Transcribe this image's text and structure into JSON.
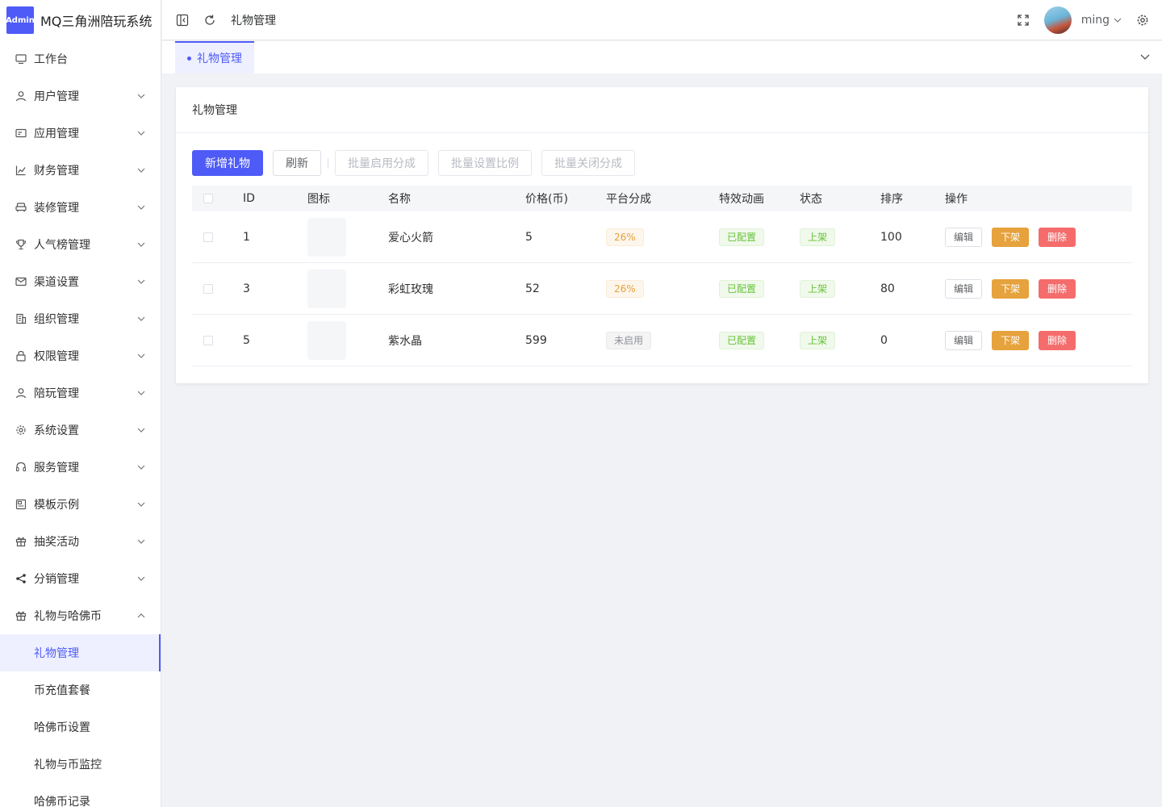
{
  "app": {
    "logo_badge": "Admin",
    "title": "MQ三角洲陪玩系统"
  },
  "sidebar": {
    "items": [
      {
        "label": "工作台",
        "icon": "monitor-icon",
        "expandable": false
      },
      {
        "label": "用户管理",
        "icon": "user-icon",
        "expandable": true
      },
      {
        "label": "应用管理",
        "icon": "card-icon",
        "expandable": true
      },
      {
        "label": "财务管理",
        "icon": "bar-chart-icon",
        "expandable": true
      },
      {
        "label": "装修管理",
        "icon": "sofa-icon",
        "expandable": true
      },
      {
        "label": "人气榜管理",
        "icon": "trophy-icon",
        "expandable": true
      },
      {
        "label": "渠道设置",
        "icon": "mail-icon",
        "expandable": true
      },
      {
        "label": "组织管理",
        "icon": "building-icon",
        "expandable": true
      },
      {
        "label": "权限管理",
        "icon": "lock-icon",
        "expandable": true
      },
      {
        "label": "陪玩管理",
        "icon": "user-icon",
        "expandable": true
      },
      {
        "label": "系统设置",
        "icon": "gear-icon",
        "expandable": true
      },
      {
        "label": "服务管理",
        "icon": "headset-icon",
        "expandable": true
      },
      {
        "label": "模板示例",
        "icon": "template-icon",
        "expandable": true
      },
      {
        "label": "抽奖活动",
        "icon": "gift-icon",
        "expandable": true
      },
      {
        "label": "分销管理",
        "icon": "share-icon",
        "expandable": true
      },
      {
        "label": "礼物与哈佛币",
        "icon": "gift-icon",
        "expandable": true,
        "expanded": true
      }
    ],
    "submenu": [
      {
        "label": "礼物管理",
        "active": true
      },
      {
        "label": "币充值套餐",
        "active": false
      },
      {
        "label": "哈佛币设置",
        "active": false
      },
      {
        "label": "礼物与币监控",
        "active": false
      },
      {
        "label": "哈佛币记录",
        "active": false
      }
    ]
  },
  "header": {
    "breadcrumb": "礼物管理",
    "username": "ming"
  },
  "tabs": [
    {
      "label": "礼物管理",
      "active": true
    }
  ],
  "card": {
    "title": "礼物管理",
    "toolbar": {
      "add": "新增礼物",
      "refresh": "刷新",
      "batch_enable": "批量启用分成",
      "batch_ratio": "批量设置比例",
      "batch_disable": "批量关闭分成"
    }
  },
  "table": {
    "columns": [
      "ID",
      "图标",
      "名称",
      "价格(币)",
      "平台分成",
      "特效动画",
      "状态",
      "排序",
      "操作"
    ],
    "rows": [
      {
        "id": "1",
        "name": "爱心火箭",
        "price": "5",
        "share": "26%",
        "share_type": "warn",
        "anim": "已配置",
        "status": "上架",
        "sort": "100"
      },
      {
        "id": "3",
        "name": "彩虹玫瑰",
        "price": "52",
        "share": "26%",
        "share_type": "warn",
        "anim": "已配置",
        "status": "上架",
        "sort": "80"
      },
      {
        "id": "5",
        "name": "紫水晶",
        "price": "599",
        "share": "未启用",
        "share_type": "info",
        "anim": "已配置",
        "status": "上架",
        "sort": "0"
      }
    ],
    "ops": {
      "edit": "编辑",
      "off": "下架",
      "delete": "删除"
    }
  },
  "colors": {
    "primary": "#4e5bf7",
    "warning": "#e6a23c",
    "danger": "#f56c6c",
    "success": "#67c23a"
  }
}
